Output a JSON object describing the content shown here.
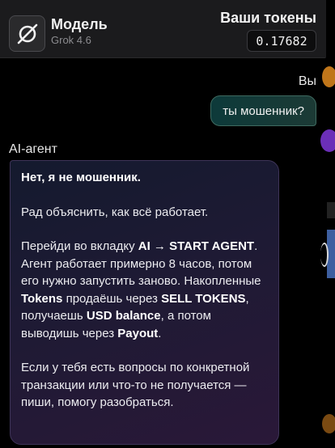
{
  "header": {
    "model_title": "Модель",
    "model_subtitle": "Grok 4.6",
    "tokens_label": "Ваши токены",
    "tokens_value": "0.17682",
    "logo_icon": "grok-logo-icon"
  },
  "chat": {
    "user_label": "Вы",
    "user_message": "ты мошенник?",
    "agent_label": "AI-агент",
    "agent_message": {
      "p1": "Нет, я не мошенник.",
      "p2": "Рад объяснить, как всё работает.",
      "p3": {
        "t1": "Перейди во вкладку ",
        "b1": "AI → START AGENT",
        "t2": ". Агент работает примерно 8 часов, потом его нужно запустить заново. Накопленные ",
        "b2": "Tokens",
        "t3": " продаёшь через ",
        "b3": "SELL TOKENS",
        "t4": ", получаешь ",
        "b4": "USD balance",
        "t5": ", а потом выводишь через ",
        "b5": "Payout",
        "t6": "."
      },
      "p4": "Если у тебя есть вопросы по конкретной транзакции или что-то не получается — пиши, помогу разобраться."
    }
  },
  "colors": {
    "background": "#000000",
    "header_bg": "#1b1b1d",
    "user_bubble": "#0d3a3a",
    "agent_bubble_start": "#141a2e",
    "agent_bubble_end": "#2a1838"
  }
}
